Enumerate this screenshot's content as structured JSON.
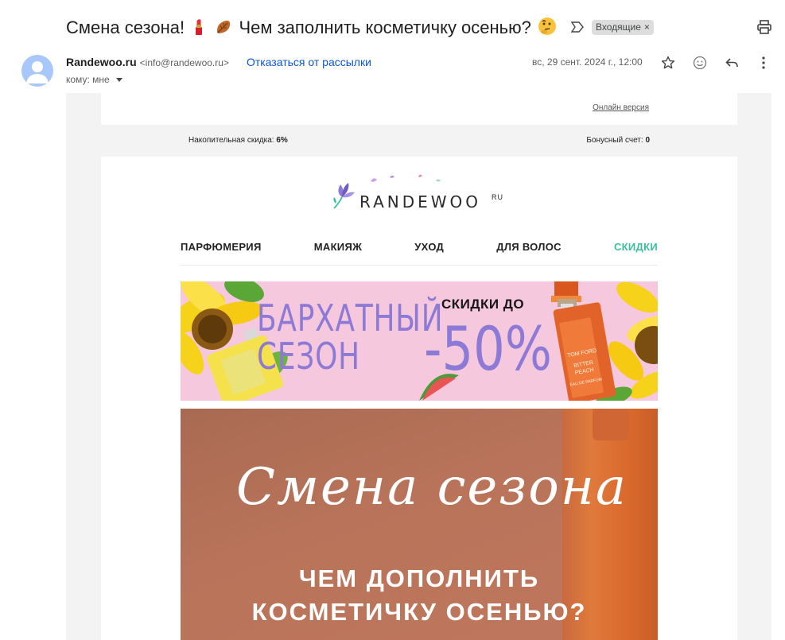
{
  "email": {
    "subject_a": "Смена сезона!",
    "subject_b": "Чем заполнить косметичку осенью?",
    "label": "Входящие",
    "label_close": "×",
    "sender_name": "Randewoo.ru",
    "sender_email": "<info@randewoo.ru>",
    "unsubscribe": "Отказаться от рассылки",
    "to": "кому: мне",
    "date": "вс, 29 сент. 2024 г., 12:00"
  },
  "icons": {
    "important": "important-icon",
    "print": "print-icon",
    "star": "star-icon",
    "emoji_react": "emoji-icon",
    "reply": "reply-icon",
    "more": "more-vert-icon"
  },
  "body": {
    "online_version": "Онлайн версия",
    "discount_label": "Накопительная скидка:",
    "discount_value": "6%",
    "bonus_label": "Бонусный счет:",
    "bonus_value": "0",
    "logo_text": "RANDEWOO",
    "logo_suffix": "RU",
    "nav": [
      "ПАРФЮМЕРИЯ",
      "МАКИЯЖ",
      "УХОД",
      "ДЛЯ ВОЛОС",
      "СКИДКИ"
    ],
    "accent_color": "#3cbf9e",
    "banner1": {
      "line1": "БАРХАТНЫЙ",
      "line2": "СЕЗОН",
      "sale_small": "СКИДКИ ДО",
      "sale_big": "-50%",
      "bottle_brand": "TOM FORD",
      "bottle_name1": "BITTER",
      "bottle_name2": "PEACH",
      "bottle_sub": "EAU DE PARFUM"
    },
    "banner2": {
      "script": "Смена сезона",
      "line1": "ЧЕМ ДОПОЛНИТЬ",
      "line2": "КОСМЕТИЧКУ ОСЕНЬЮ?"
    }
  }
}
